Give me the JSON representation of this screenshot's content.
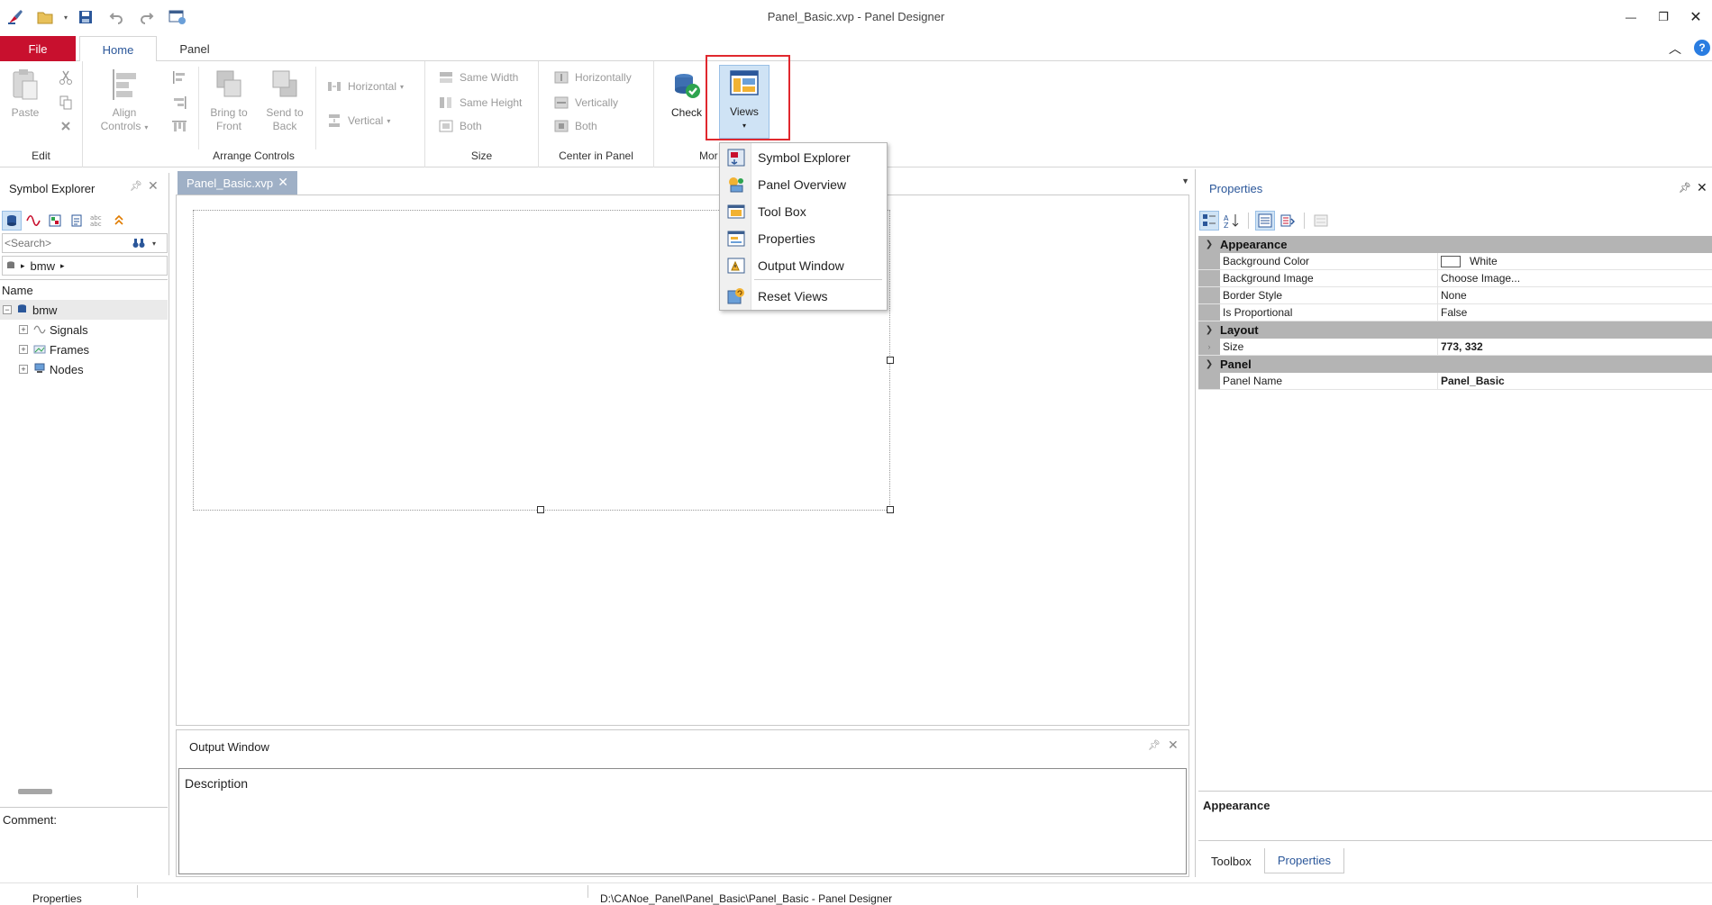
{
  "window": {
    "title": "Panel_Basic.xvp - Panel Designer",
    "minimize": "—",
    "restore": "❐",
    "close": "✕"
  },
  "ribbon_tabs": {
    "file": "File",
    "home": "Home",
    "panel": "Panel"
  },
  "ribbon": {
    "edit": {
      "label": "Edit",
      "paste": "Paste"
    },
    "arrange": {
      "label": "Arrange Controls",
      "align_line1": "Align",
      "align_line2": "Controls",
      "bring_line1": "Bring to",
      "bring_line2": "Front",
      "send_line1": "Send to",
      "send_line2": "Back",
      "horizontal": "Horizontal",
      "vertical": "Vertical"
    },
    "size": {
      "label": "Size",
      "same_width": "Same Width",
      "same_height": "Same Height",
      "both": "Both"
    },
    "center": {
      "label": "Center in Panel",
      "horizontally": "Horizontally",
      "vertically": "Vertically",
      "both": "Both"
    },
    "more": {
      "label_partial": "Mor",
      "check": "Check",
      "views": "Views"
    }
  },
  "views_menu": {
    "items": [
      "Symbol Explorer",
      "Panel Overview",
      "Tool Box",
      "Properties",
      "Output Window"
    ],
    "reset": "Reset Views"
  },
  "symbol_explorer": {
    "title": "Symbol Explorer",
    "search_placeholder": "<Search>",
    "breadcrumb": "bmw",
    "column_name": "Name",
    "tree": {
      "root": "bmw",
      "children": [
        "Signals",
        "Frames",
        "Nodes"
      ]
    },
    "comment_label": "Comment:"
  },
  "document": {
    "tab_label": "Panel_Basic.xvp"
  },
  "output_window": {
    "title": "Output Window",
    "column": "Description"
  },
  "properties": {
    "title": "Properties",
    "categories": {
      "appearance": {
        "label": "Appearance",
        "rows": [
          {
            "name": "Background Color",
            "value": "White"
          },
          {
            "name": "Background Image",
            "value": "Choose Image..."
          },
          {
            "name": "Border Style",
            "value": "None"
          },
          {
            "name": "Is Proportional",
            "value": "False"
          }
        ]
      },
      "layout": {
        "label": "Layout",
        "rows": [
          {
            "name": "Size",
            "value": "773, 332"
          }
        ]
      },
      "panel": {
        "label": "Panel",
        "rows": [
          {
            "name": "Panel Name",
            "value": "Panel_Basic"
          }
        ]
      }
    },
    "description_title": "Appearance",
    "bottom_tabs": [
      "Toolbox",
      "Properties"
    ]
  },
  "statusbar": {
    "left": "Properties",
    "right": "D:\\CANoe_Panel\\Panel_Basic\\Panel_Basic - Panel Designer"
  },
  "colors": {
    "file_tab": "#c8102e",
    "accent": "#2b579a",
    "highlight_border": "#e0282e",
    "selection": "#cfe3f5"
  }
}
